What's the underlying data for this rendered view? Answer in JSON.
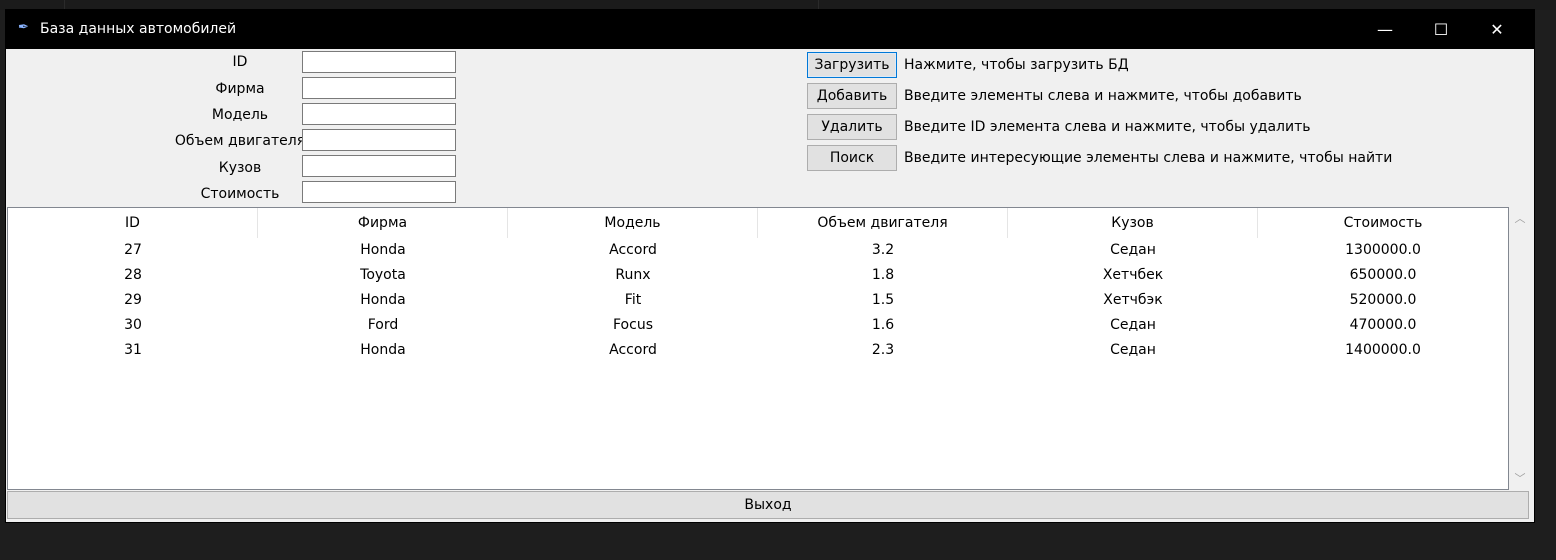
{
  "window": {
    "title": "База данных автомобилей",
    "controls": {
      "minimize": "—",
      "maximize": "☐",
      "close": "✕"
    }
  },
  "form": {
    "fields": [
      {
        "label": "ID",
        "value": ""
      },
      {
        "label": "Фирма",
        "value": ""
      },
      {
        "label": "Модель",
        "value": ""
      },
      {
        "label": "Объем двигателя",
        "value": ""
      },
      {
        "label": "Кузов",
        "value": ""
      },
      {
        "label": "Стоимость",
        "value": ""
      }
    ]
  },
  "actions": [
    {
      "label": "Загрузить",
      "description": "Нажмите, чтобы загрузить БД"
    },
    {
      "label": "Добавить",
      "description": "Введите элементы слева и нажмите, чтобы добавить"
    },
    {
      "label": "Удалить",
      "description": "Введите ID элемента слева и нажмите, чтобы удалить"
    },
    {
      "label": "Поиск",
      "description": "Введите интересующие элементы слева и нажмите, чтобы найти"
    }
  ],
  "table": {
    "columns": [
      "ID",
      "Фирма",
      "Модель",
      "Объем двигателя",
      "Кузов",
      "Стоимость"
    ],
    "rows": [
      [
        "27",
        "Honda",
        "Accord",
        "3.2",
        "Седан",
        "1300000.0"
      ],
      [
        "28",
        "Toyota",
        "Runx",
        "1.8",
        "Хетчбек",
        "650000.0"
      ],
      [
        "29",
        "Honda",
        "Fit",
        "1.5",
        "Хетчбэк",
        "520000.0"
      ],
      [
        "30",
        "Ford",
        "Focus",
        "1.6",
        "Седан",
        "470000.0"
      ],
      [
        "31",
        "Honda",
        "Accord",
        "2.3",
        "Седан",
        "1400000.0"
      ]
    ]
  },
  "footer": {
    "exit_label": "Выход"
  },
  "colors": {
    "titlebar": "#000000",
    "window_bg": "#f0f0f0",
    "focus_border": "#0078d7"
  }
}
